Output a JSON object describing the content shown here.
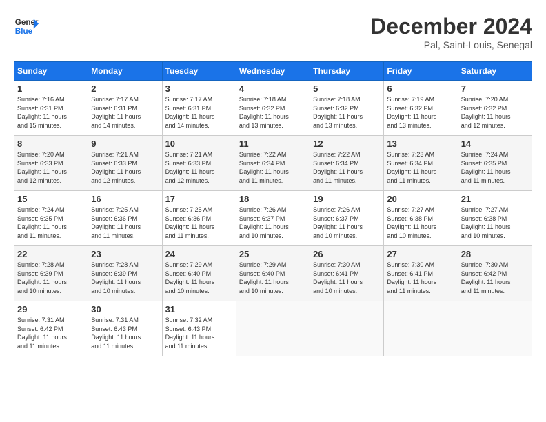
{
  "header": {
    "logo_general": "General",
    "logo_blue": "Blue",
    "month_title": "December 2024",
    "location": "Pal, Saint-Louis, Senegal"
  },
  "calendar": {
    "days_of_week": [
      "Sunday",
      "Monday",
      "Tuesday",
      "Wednesday",
      "Thursday",
      "Friday",
      "Saturday"
    ],
    "weeks": [
      [
        {
          "num": "",
          "info": ""
        },
        {
          "num": "2",
          "info": "Sunrise: 7:17 AM\nSunset: 6:31 PM\nDaylight: 11 hours\nand 14 minutes."
        },
        {
          "num": "3",
          "info": "Sunrise: 7:17 AM\nSunset: 6:31 PM\nDaylight: 11 hours\nand 14 minutes."
        },
        {
          "num": "4",
          "info": "Sunrise: 7:18 AM\nSunset: 6:32 PM\nDaylight: 11 hours\nand 13 minutes."
        },
        {
          "num": "5",
          "info": "Sunrise: 7:18 AM\nSunset: 6:32 PM\nDaylight: 11 hours\nand 13 minutes."
        },
        {
          "num": "6",
          "info": "Sunrise: 7:19 AM\nSunset: 6:32 PM\nDaylight: 11 hours\nand 13 minutes."
        },
        {
          "num": "7",
          "info": "Sunrise: 7:20 AM\nSunset: 6:32 PM\nDaylight: 11 hours\nand 12 minutes."
        }
      ],
      [
        {
          "num": "1",
          "info": "Sunrise: 7:16 AM\nSunset: 6:31 PM\nDaylight: 11 hours\nand 15 minutes."
        },
        {
          "num": "",
          "info": ""
        },
        {
          "num": "",
          "info": ""
        },
        {
          "num": "",
          "info": ""
        },
        {
          "num": "",
          "info": ""
        },
        {
          "num": "",
          "info": ""
        },
        {
          "num": "",
          "info": ""
        }
      ],
      [
        {
          "num": "8",
          "info": "Sunrise: 7:20 AM\nSunset: 6:33 PM\nDaylight: 11 hours\nand 12 minutes."
        },
        {
          "num": "9",
          "info": "Sunrise: 7:21 AM\nSunset: 6:33 PM\nDaylight: 11 hours\nand 12 minutes."
        },
        {
          "num": "10",
          "info": "Sunrise: 7:21 AM\nSunset: 6:33 PM\nDaylight: 11 hours\nand 12 minutes."
        },
        {
          "num": "11",
          "info": "Sunrise: 7:22 AM\nSunset: 6:34 PM\nDaylight: 11 hours\nand 11 minutes."
        },
        {
          "num": "12",
          "info": "Sunrise: 7:22 AM\nSunset: 6:34 PM\nDaylight: 11 hours\nand 11 minutes."
        },
        {
          "num": "13",
          "info": "Sunrise: 7:23 AM\nSunset: 6:34 PM\nDaylight: 11 hours\nand 11 minutes."
        },
        {
          "num": "14",
          "info": "Sunrise: 7:24 AM\nSunset: 6:35 PM\nDaylight: 11 hours\nand 11 minutes."
        }
      ],
      [
        {
          "num": "15",
          "info": "Sunrise: 7:24 AM\nSunset: 6:35 PM\nDaylight: 11 hours\nand 11 minutes."
        },
        {
          "num": "16",
          "info": "Sunrise: 7:25 AM\nSunset: 6:36 PM\nDaylight: 11 hours\nand 11 minutes."
        },
        {
          "num": "17",
          "info": "Sunrise: 7:25 AM\nSunset: 6:36 PM\nDaylight: 11 hours\nand 11 minutes."
        },
        {
          "num": "18",
          "info": "Sunrise: 7:26 AM\nSunset: 6:37 PM\nDaylight: 11 hours\nand 10 minutes."
        },
        {
          "num": "19",
          "info": "Sunrise: 7:26 AM\nSunset: 6:37 PM\nDaylight: 11 hours\nand 10 minutes."
        },
        {
          "num": "20",
          "info": "Sunrise: 7:27 AM\nSunset: 6:38 PM\nDaylight: 11 hours\nand 10 minutes."
        },
        {
          "num": "21",
          "info": "Sunrise: 7:27 AM\nSunset: 6:38 PM\nDaylight: 11 hours\nand 10 minutes."
        }
      ],
      [
        {
          "num": "22",
          "info": "Sunrise: 7:28 AM\nSunset: 6:39 PM\nDaylight: 11 hours\nand 10 minutes."
        },
        {
          "num": "23",
          "info": "Sunrise: 7:28 AM\nSunset: 6:39 PM\nDaylight: 11 hours\nand 10 minutes."
        },
        {
          "num": "24",
          "info": "Sunrise: 7:29 AM\nSunset: 6:40 PM\nDaylight: 11 hours\nand 10 minutes."
        },
        {
          "num": "25",
          "info": "Sunrise: 7:29 AM\nSunset: 6:40 PM\nDaylight: 11 hours\nand 10 minutes."
        },
        {
          "num": "26",
          "info": "Sunrise: 7:30 AM\nSunset: 6:41 PM\nDaylight: 11 hours\nand 10 minutes."
        },
        {
          "num": "27",
          "info": "Sunrise: 7:30 AM\nSunset: 6:41 PM\nDaylight: 11 hours\nand 11 minutes."
        },
        {
          "num": "28",
          "info": "Sunrise: 7:30 AM\nSunset: 6:42 PM\nDaylight: 11 hours\nand 11 minutes."
        }
      ],
      [
        {
          "num": "29",
          "info": "Sunrise: 7:31 AM\nSunset: 6:42 PM\nDaylight: 11 hours\nand 11 minutes."
        },
        {
          "num": "30",
          "info": "Sunrise: 7:31 AM\nSunset: 6:43 PM\nDaylight: 11 hours\nand 11 minutes."
        },
        {
          "num": "31",
          "info": "Sunrise: 7:32 AM\nSunset: 6:43 PM\nDaylight: 11 hours\nand 11 minutes."
        },
        {
          "num": "",
          "info": ""
        },
        {
          "num": "",
          "info": ""
        },
        {
          "num": "",
          "info": ""
        },
        {
          "num": "",
          "info": ""
        }
      ]
    ]
  }
}
